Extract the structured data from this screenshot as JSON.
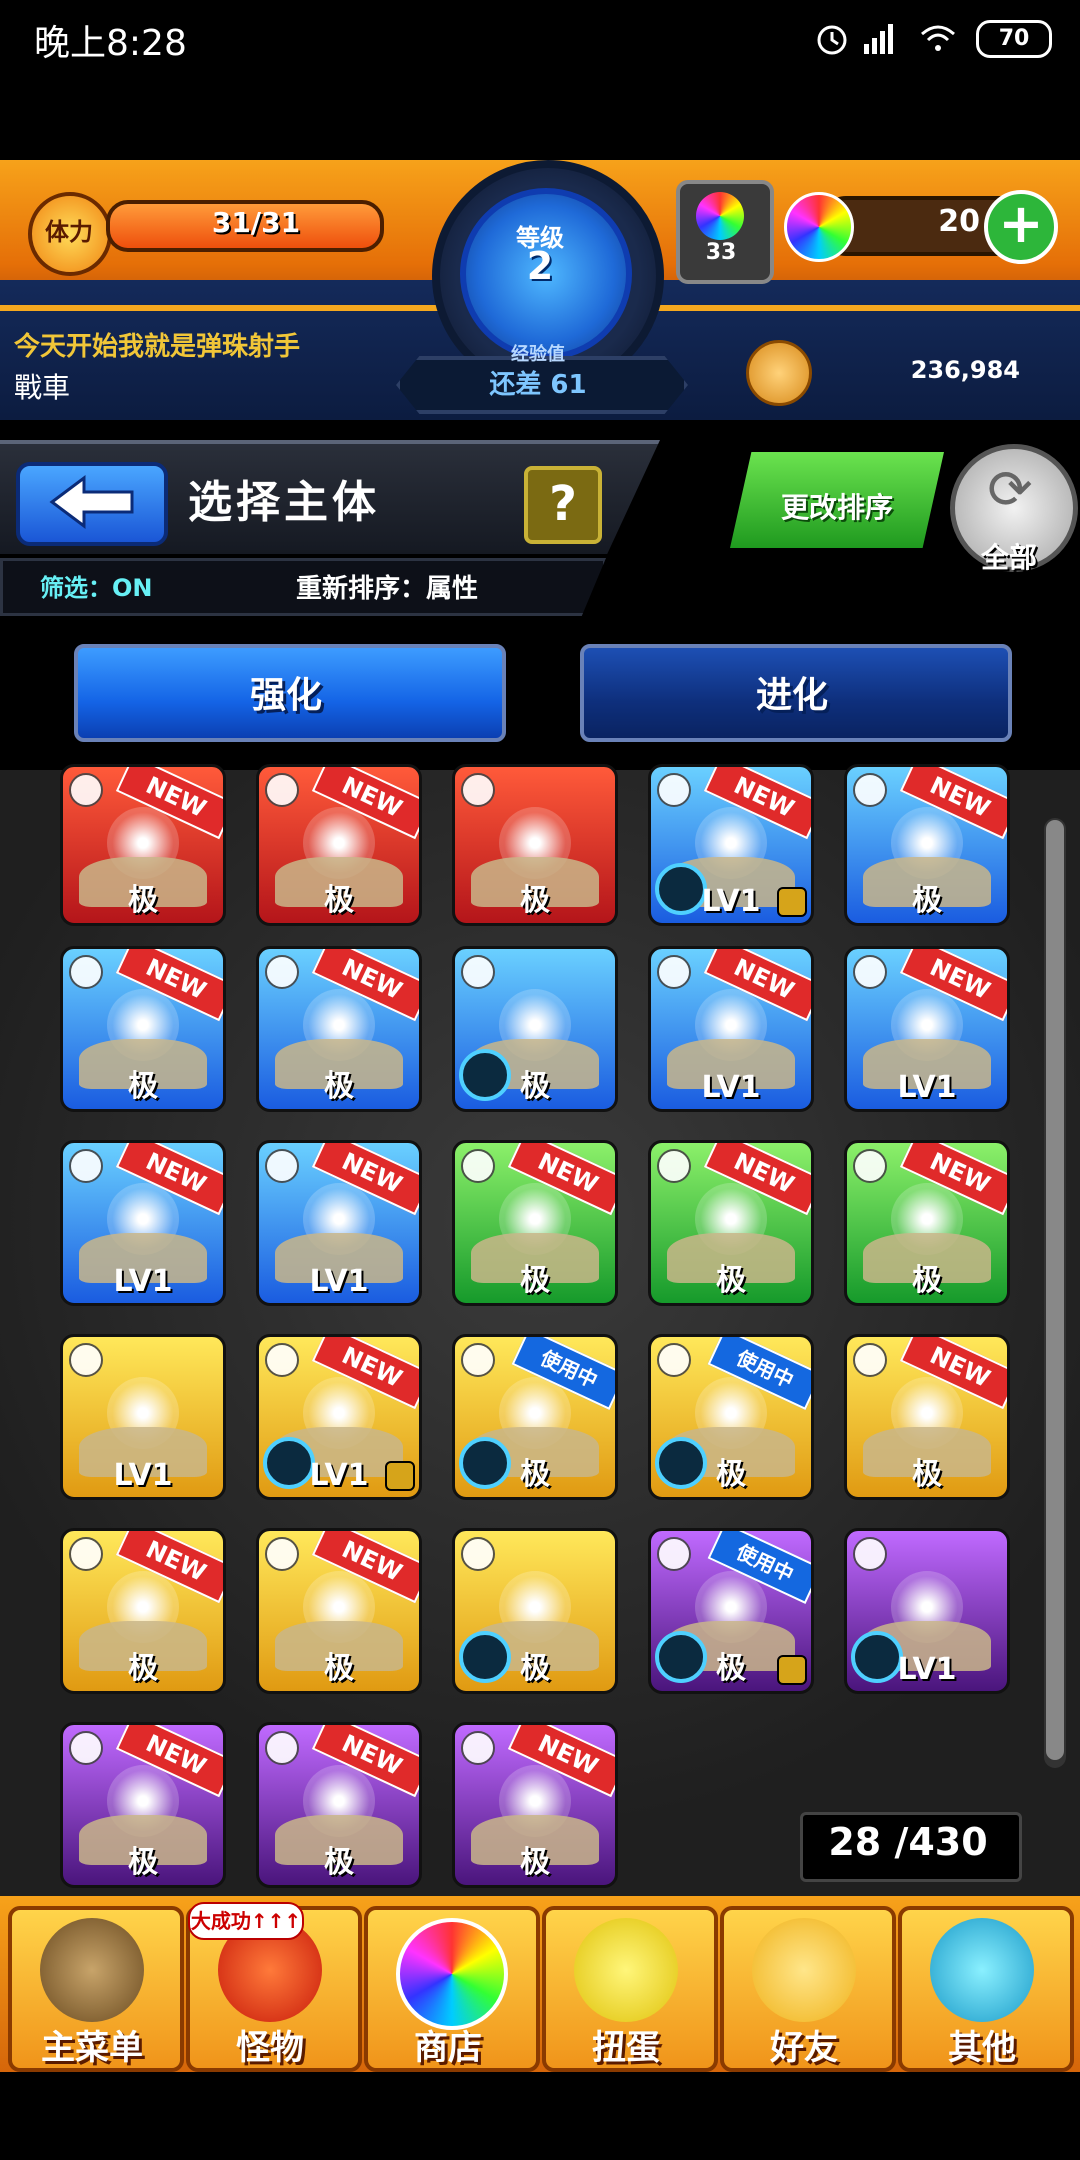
{
  "status_bar": {
    "time": "晚上8:28",
    "battery": "70"
  },
  "header": {
    "stamina_label": "体力",
    "stamina_text": "31/31",
    "stamina_fraction": 1.0,
    "level_label": "等级",
    "level_value": "2",
    "exp_label": "经验值",
    "exp_value": "还差 61",
    "orb_gauge_count": "33",
    "orb_count": "20",
    "orb_plus": "+",
    "player_title": "今天开始我就是弹珠射手",
    "player_name": "戰車",
    "coins": "236,984"
  },
  "title_bar": {
    "back_icon": "back-arrow-icon",
    "title": "选择主体",
    "help": "?",
    "filter": "筛选：ON",
    "sort": "重新排序：属性",
    "sort_button": "更改排序",
    "all_button": "全部"
  },
  "tabs": {
    "power": "强化",
    "evolve": "进化"
  },
  "monsters": [
    {
      "element": "fire",
      "badge": "NEW",
      "level": "极"
    },
    {
      "element": "fire",
      "badge": "NEW",
      "level": "极"
    },
    {
      "element": "fire",
      "badge": "",
      "level": "极"
    },
    {
      "element": "water",
      "badge": "NEW",
      "level": "LV1",
      "lock": true,
      "skill": true
    },
    {
      "element": "water",
      "badge": "NEW",
      "level": "极"
    },
    {
      "element": "water",
      "badge": "NEW",
      "level": "极"
    },
    {
      "element": "water",
      "badge": "NEW",
      "level": "极"
    },
    {
      "element": "water",
      "badge": "",
      "level": "极",
      "skill": true
    },
    {
      "element": "water",
      "badge": "NEW",
      "level": "LV1"
    },
    {
      "element": "water",
      "badge": "NEW",
      "level": "LV1"
    },
    {
      "element": "water",
      "badge": "NEW",
      "level": "LV1"
    },
    {
      "element": "water",
      "badge": "NEW",
      "level": "LV1"
    },
    {
      "element": "wood",
      "badge": "NEW",
      "level": "极"
    },
    {
      "element": "wood",
      "badge": "NEW",
      "level": "极"
    },
    {
      "element": "wood",
      "badge": "NEW",
      "level": "极"
    },
    {
      "element": "light",
      "badge": "",
      "level": "LV1"
    },
    {
      "element": "light",
      "badge": "NEW",
      "level": "LV1",
      "lock": true,
      "skill": true
    },
    {
      "element": "light",
      "badge": "使用中",
      "level": "极",
      "skill": true
    },
    {
      "element": "light",
      "badge": "使用中",
      "level": "极",
      "skill": true
    },
    {
      "element": "light",
      "badge": "NEW",
      "level": "极"
    },
    {
      "element": "light",
      "badge": "NEW",
      "level": "极"
    },
    {
      "element": "light",
      "badge": "NEW",
      "level": "极"
    },
    {
      "element": "light",
      "badge": "",
      "level": "极",
      "skill": true
    },
    {
      "element": "dark",
      "badge": "使用中",
      "level": "极",
      "lock": true,
      "skill": true
    },
    {
      "element": "dark",
      "badge": "",
      "level": "LV1",
      "skill": true
    },
    {
      "element": "dark",
      "badge": "NEW",
      "level": "极"
    },
    {
      "element": "dark",
      "badge": "NEW",
      "level": "极"
    },
    {
      "element": "dark",
      "badge": "NEW",
      "level": "极"
    }
  ],
  "box_count": "28 /430",
  "bottom_nav": {
    "badge": "大成功↑↑↑",
    "items": [
      "主菜单",
      "怪物",
      "商店",
      "扭蛋",
      "好友",
      "其他"
    ]
  }
}
